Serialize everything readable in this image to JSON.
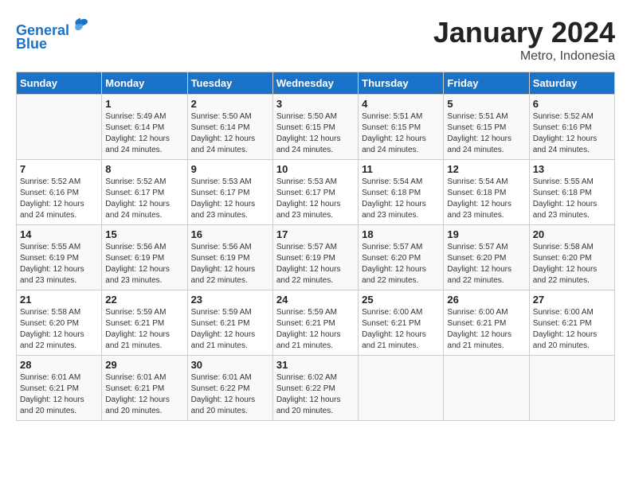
{
  "header": {
    "logo_line1": "General",
    "logo_line2": "Blue",
    "month": "January 2024",
    "location": "Metro, Indonesia"
  },
  "weekdays": [
    "Sunday",
    "Monday",
    "Tuesday",
    "Wednesday",
    "Thursday",
    "Friday",
    "Saturday"
  ],
  "weeks": [
    [
      {
        "day": "",
        "info": ""
      },
      {
        "day": "1",
        "info": "Sunrise: 5:49 AM\nSunset: 6:14 PM\nDaylight: 12 hours\nand 24 minutes."
      },
      {
        "day": "2",
        "info": "Sunrise: 5:50 AM\nSunset: 6:14 PM\nDaylight: 12 hours\nand 24 minutes."
      },
      {
        "day": "3",
        "info": "Sunrise: 5:50 AM\nSunset: 6:15 PM\nDaylight: 12 hours\nand 24 minutes."
      },
      {
        "day": "4",
        "info": "Sunrise: 5:51 AM\nSunset: 6:15 PM\nDaylight: 12 hours\nand 24 minutes."
      },
      {
        "day": "5",
        "info": "Sunrise: 5:51 AM\nSunset: 6:15 PM\nDaylight: 12 hours\nand 24 minutes."
      },
      {
        "day": "6",
        "info": "Sunrise: 5:52 AM\nSunset: 6:16 PM\nDaylight: 12 hours\nand 24 minutes."
      }
    ],
    [
      {
        "day": "7",
        "info": "Sunrise: 5:52 AM\nSunset: 6:16 PM\nDaylight: 12 hours\nand 24 minutes."
      },
      {
        "day": "8",
        "info": "Sunrise: 5:52 AM\nSunset: 6:17 PM\nDaylight: 12 hours\nand 24 minutes."
      },
      {
        "day": "9",
        "info": "Sunrise: 5:53 AM\nSunset: 6:17 PM\nDaylight: 12 hours\nand 23 minutes."
      },
      {
        "day": "10",
        "info": "Sunrise: 5:53 AM\nSunset: 6:17 PM\nDaylight: 12 hours\nand 23 minutes."
      },
      {
        "day": "11",
        "info": "Sunrise: 5:54 AM\nSunset: 6:18 PM\nDaylight: 12 hours\nand 23 minutes."
      },
      {
        "day": "12",
        "info": "Sunrise: 5:54 AM\nSunset: 6:18 PM\nDaylight: 12 hours\nand 23 minutes."
      },
      {
        "day": "13",
        "info": "Sunrise: 5:55 AM\nSunset: 6:18 PM\nDaylight: 12 hours\nand 23 minutes."
      }
    ],
    [
      {
        "day": "14",
        "info": "Sunrise: 5:55 AM\nSunset: 6:19 PM\nDaylight: 12 hours\nand 23 minutes."
      },
      {
        "day": "15",
        "info": "Sunrise: 5:56 AM\nSunset: 6:19 PM\nDaylight: 12 hours\nand 23 minutes."
      },
      {
        "day": "16",
        "info": "Sunrise: 5:56 AM\nSunset: 6:19 PM\nDaylight: 12 hours\nand 22 minutes."
      },
      {
        "day": "17",
        "info": "Sunrise: 5:57 AM\nSunset: 6:19 PM\nDaylight: 12 hours\nand 22 minutes."
      },
      {
        "day": "18",
        "info": "Sunrise: 5:57 AM\nSunset: 6:20 PM\nDaylight: 12 hours\nand 22 minutes."
      },
      {
        "day": "19",
        "info": "Sunrise: 5:57 AM\nSunset: 6:20 PM\nDaylight: 12 hours\nand 22 minutes."
      },
      {
        "day": "20",
        "info": "Sunrise: 5:58 AM\nSunset: 6:20 PM\nDaylight: 12 hours\nand 22 minutes."
      }
    ],
    [
      {
        "day": "21",
        "info": "Sunrise: 5:58 AM\nSunset: 6:20 PM\nDaylight: 12 hours\nand 22 minutes."
      },
      {
        "day": "22",
        "info": "Sunrise: 5:59 AM\nSunset: 6:21 PM\nDaylight: 12 hours\nand 21 minutes."
      },
      {
        "day": "23",
        "info": "Sunrise: 5:59 AM\nSunset: 6:21 PM\nDaylight: 12 hours\nand 21 minutes."
      },
      {
        "day": "24",
        "info": "Sunrise: 5:59 AM\nSunset: 6:21 PM\nDaylight: 12 hours\nand 21 minutes."
      },
      {
        "day": "25",
        "info": "Sunrise: 6:00 AM\nSunset: 6:21 PM\nDaylight: 12 hours\nand 21 minutes."
      },
      {
        "day": "26",
        "info": "Sunrise: 6:00 AM\nSunset: 6:21 PM\nDaylight: 12 hours\nand 21 minutes."
      },
      {
        "day": "27",
        "info": "Sunrise: 6:00 AM\nSunset: 6:21 PM\nDaylight: 12 hours\nand 20 minutes."
      }
    ],
    [
      {
        "day": "28",
        "info": "Sunrise: 6:01 AM\nSunset: 6:21 PM\nDaylight: 12 hours\nand 20 minutes."
      },
      {
        "day": "29",
        "info": "Sunrise: 6:01 AM\nSunset: 6:21 PM\nDaylight: 12 hours\nand 20 minutes."
      },
      {
        "day": "30",
        "info": "Sunrise: 6:01 AM\nSunset: 6:22 PM\nDaylight: 12 hours\nand 20 minutes."
      },
      {
        "day": "31",
        "info": "Sunrise: 6:02 AM\nSunset: 6:22 PM\nDaylight: 12 hours\nand 20 minutes."
      },
      {
        "day": "",
        "info": ""
      },
      {
        "day": "",
        "info": ""
      },
      {
        "day": "",
        "info": ""
      }
    ]
  ]
}
